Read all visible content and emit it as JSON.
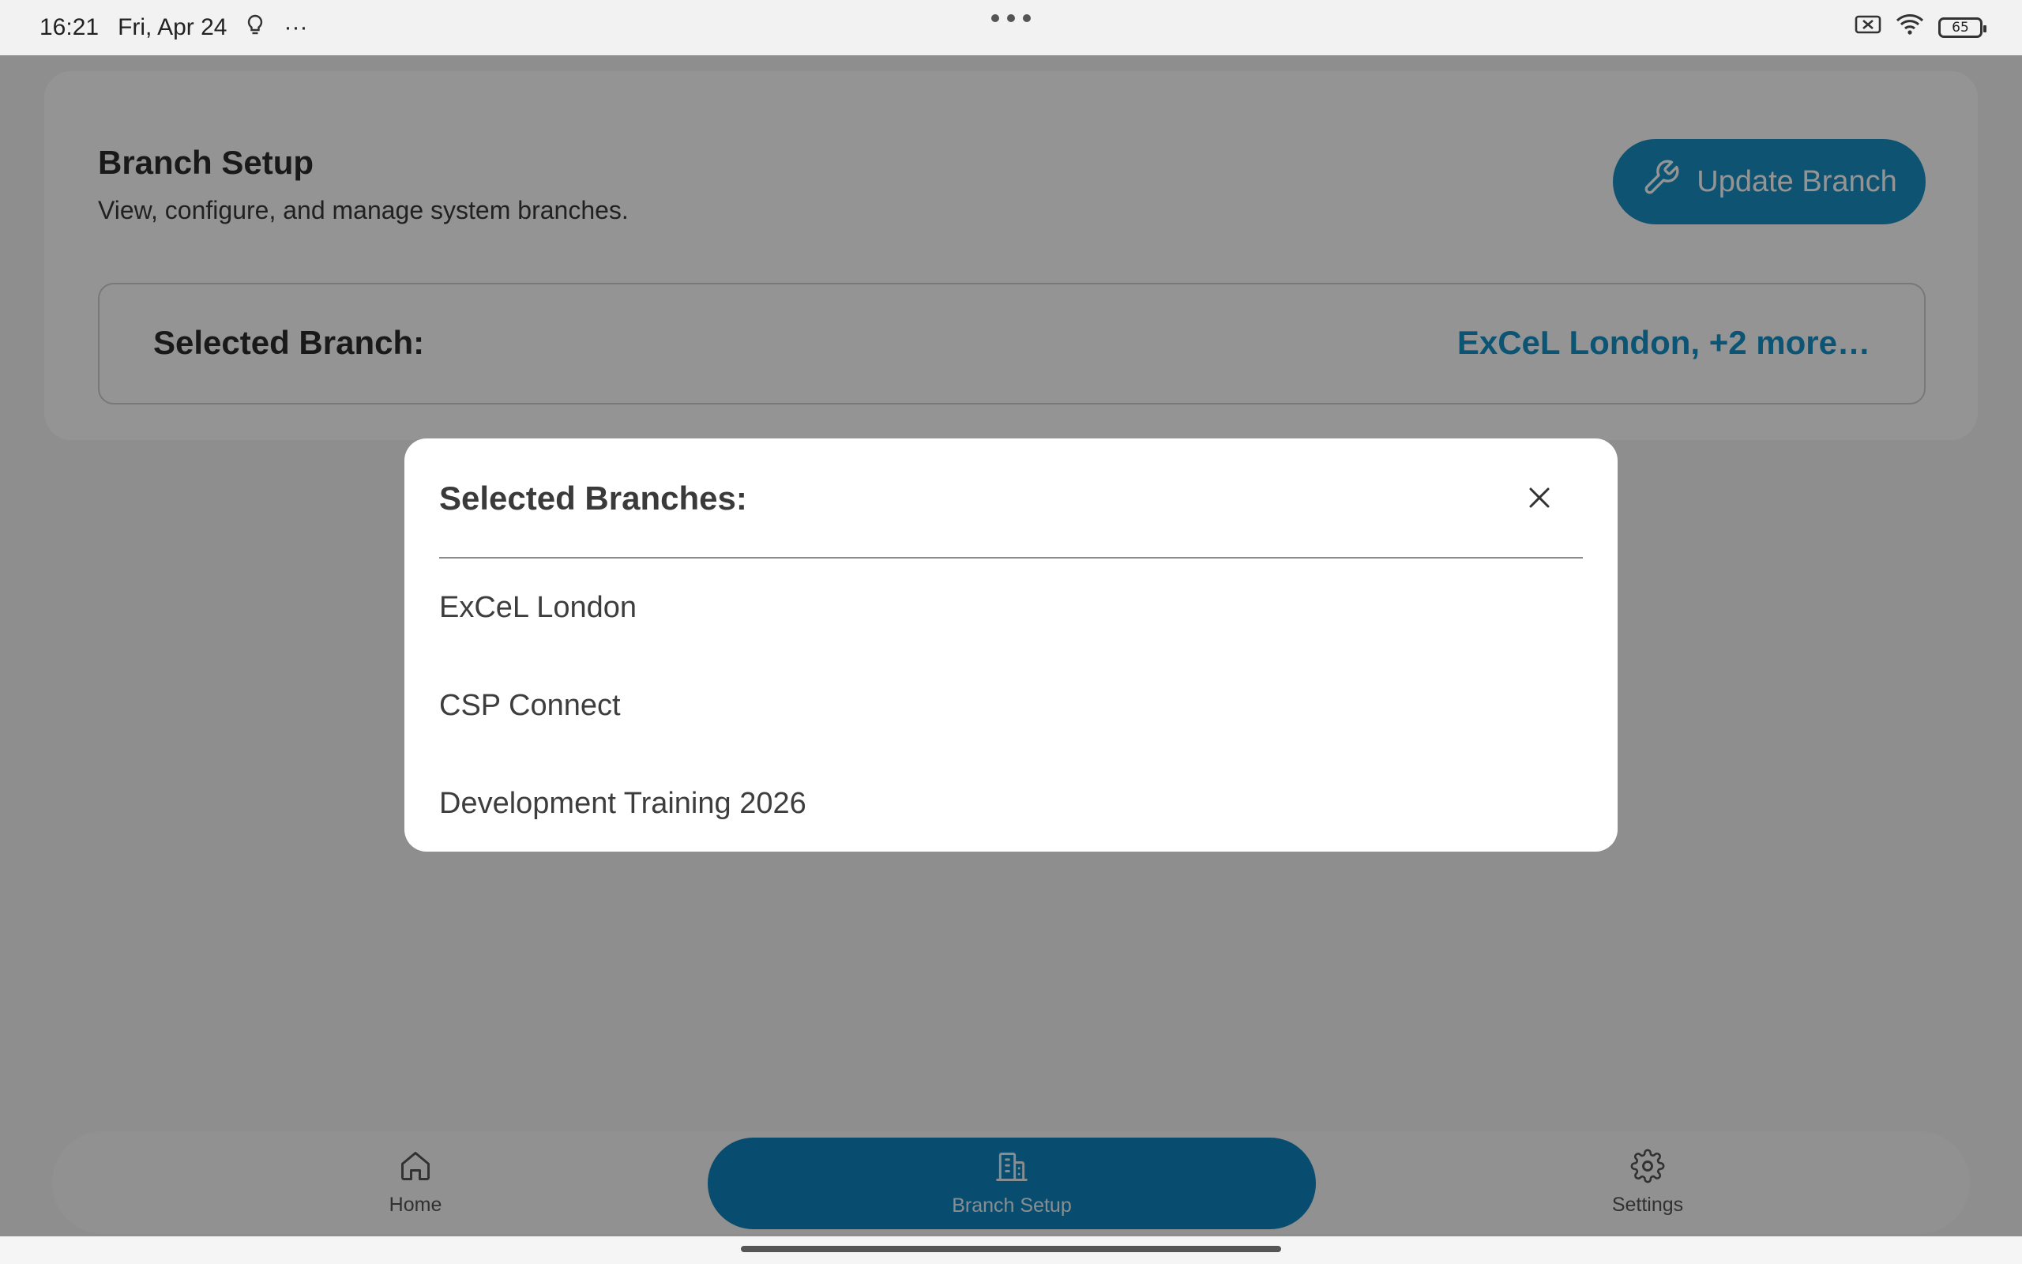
{
  "status_bar": {
    "time": "16:21",
    "date": "Fri, Apr 24",
    "more": "···",
    "battery": "65"
  },
  "branch_setup": {
    "title": "Branch Setup",
    "subtitle": "View, configure, and manage system branches.",
    "update_button_label": "Update Branch",
    "selected_label": "Selected Branch:",
    "selected_value": "ExCeL London, +2 more…"
  },
  "dialog": {
    "title": "Selected Branches:",
    "branches": [
      "ExCeL London",
      "CSP Connect",
      "Development Training 2026"
    ]
  },
  "bottom_nav": {
    "items": [
      {
        "label": "Home",
        "icon": "home-icon"
      },
      {
        "label": "Branch Setup",
        "icon": "building-icon"
      },
      {
        "label": "Settings",
        "icon": "gear-icon"
      }
    ],
    "active_index": 1
  },
  "colors": {
    "accent": "#1b8fc4",
    "accent_text": "#1592c9",
    "nav_active": "#0f86bf"
  }
}
